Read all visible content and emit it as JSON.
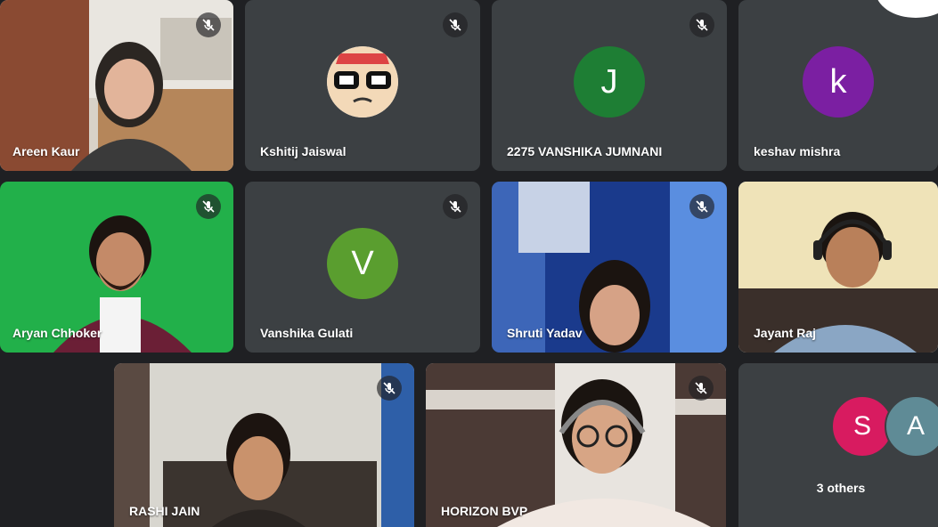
{
  "participants": [
    {
      "name": "Areen Kaur",
      "type": "video"
    },
    {
      "name": "Kshitij Jaiswal",
      "type": "avatar-image",
      "icon": "cartoon-avatar-icon"
    },
    {
      "name": "2275 VANSHIKA JUMNANI",
      "type": "avatar",
      "initial": "J",
      "color": "#1e7e34"
    },
    {
      "name": "keshav mishra",
      "type": "avatar",
      "initial": "k",
      "color": "#7b1fa2"
    },
    {
      "name": "Aryan Chhoker",
      "type": "video"
    },
    {
      "name": "Vanshika Gulati",
      "type": "avatar",
      "initial": "V",
      "color": "#5a9e2f"
    },
    {
      "name": "Shruti Yadav",
      "type": "video"
    },
    {
      "name": "Jayant Raj",
      "type": "video",
      "active": true
    },
    {
      "name": "RASHI JAIN",
      "type": "video"
    },
    {
      "name": "HORIZON BVP",
      "type": "video"
    }
  ],
  "others": {
    "label": "3 others",
    "avatars": [
      {
        "initial": "S",
        "color": "#d81b60"
      },
      {
        "initial": "A",
        "color": "#5f8b96"
      }
    ]
  },
  "colors": {
    "background": "#1f2023",
    "tile": "#3c4043",
    "active_border": "#8ab4f8"
  },
  "icons": {
    "muted": "mic-off-icon"
  }
}
